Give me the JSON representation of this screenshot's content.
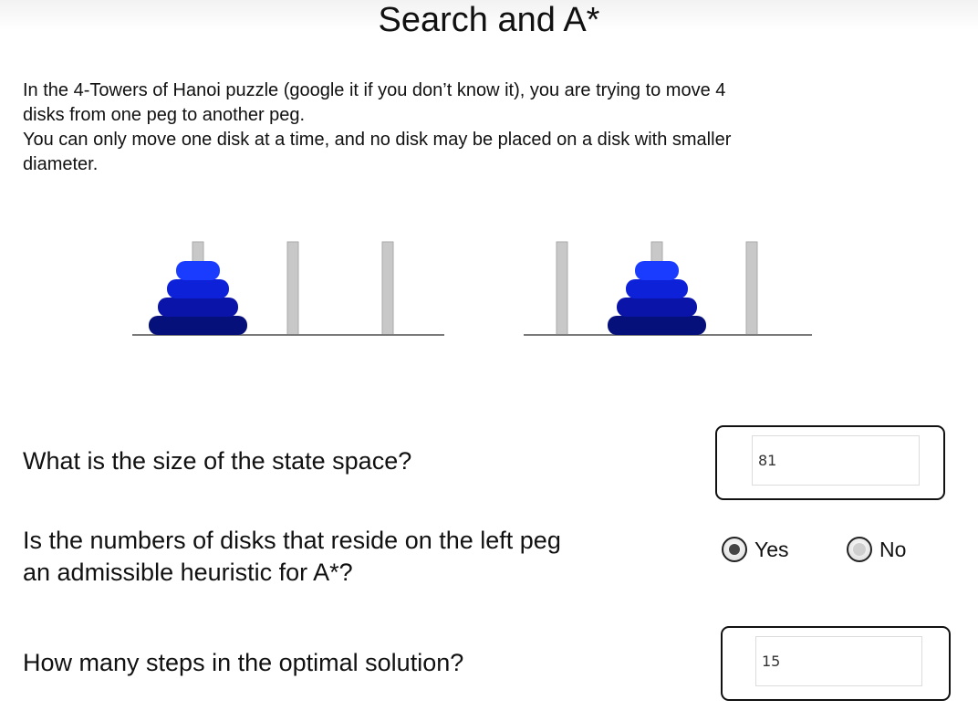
{
  "page": {
    "title": "Search and A*"
  },
  "intro": {
    "line1": "In the 4-Towers of Hanoi puzzle (google it if you don’t know it), you are trying to move 4",
    "line2": "disks from one peg to another peg.",
    "line3": "You can only move one disk at a time, and no disk may be placed on a disk with smaller",
    "line4": "diameter."
  },
  "illustration": {
    "disk_colors": [
      "#1a3cff",
      "#0d22d8",
      "#0a14a8",
      "#06107a"
    ],
    "peg_color": "#c8c8c8",
    "base_color": "#7a7a7a"
  },
  "questions": [
    {
      "text": "What is the size of the state space?",
      "answer": "81"
    },
    {
      "text_line1": "Is the numbers of disks that reside on the left peg",
      "text_line2": "an admissible heuristic for A*?",
      "options": [
        {
          "label": "Yes",
          "selected": true
        },
        {
          "label": "No",
          "selected": false
        }
      ]
    },
    {
      "text": "How many steps in the optimal solution?",
      "answer": "15"
    }
  ]
}
